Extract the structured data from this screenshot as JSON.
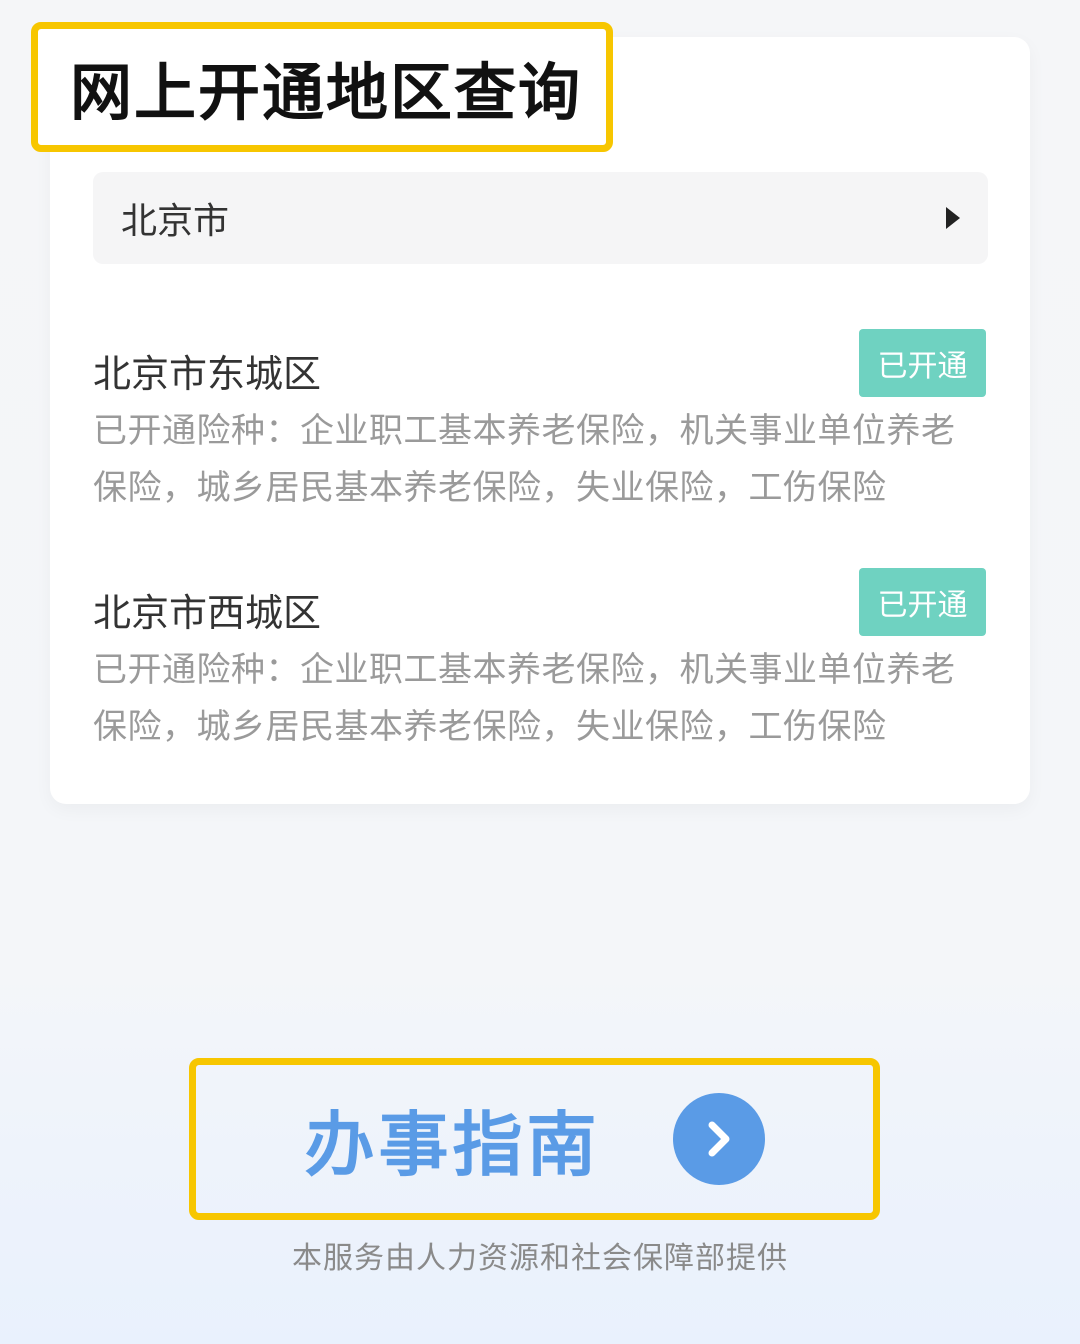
{
  "page_title": "网上开通地区查询",
  "city_selector": {
    "value": "北京市",
    "icon": "caret-right-icon"
  },
  "districts": [
    {
      "name": "北京市东城区",
      "status": "已开通",
      "desc": "已开通险种：企业职工基本养老保险，机关事业单位养老保险，城乡居民基本养老保险，失业保险，工伤保险"
    },
    {
      "name": "北京市西城区",
      "status": "已开通",
      "desc": "已开通险种：企业职工基本养老保险，机关事业单位养老保险，城乡居民基本养老保险，失业保险，工伤保险"
    }
  ],
  "guide": {
    "label": "办事指南",
    "icon": "chevron-right-icon"
  },
  "footer": "本服务由人力资源和社会保障部提供",
  "colors": {
    "highlight": "#f7c600",
    "badge": "#6fd2c1",
    "accent": "#5a9be6"
  }
}
